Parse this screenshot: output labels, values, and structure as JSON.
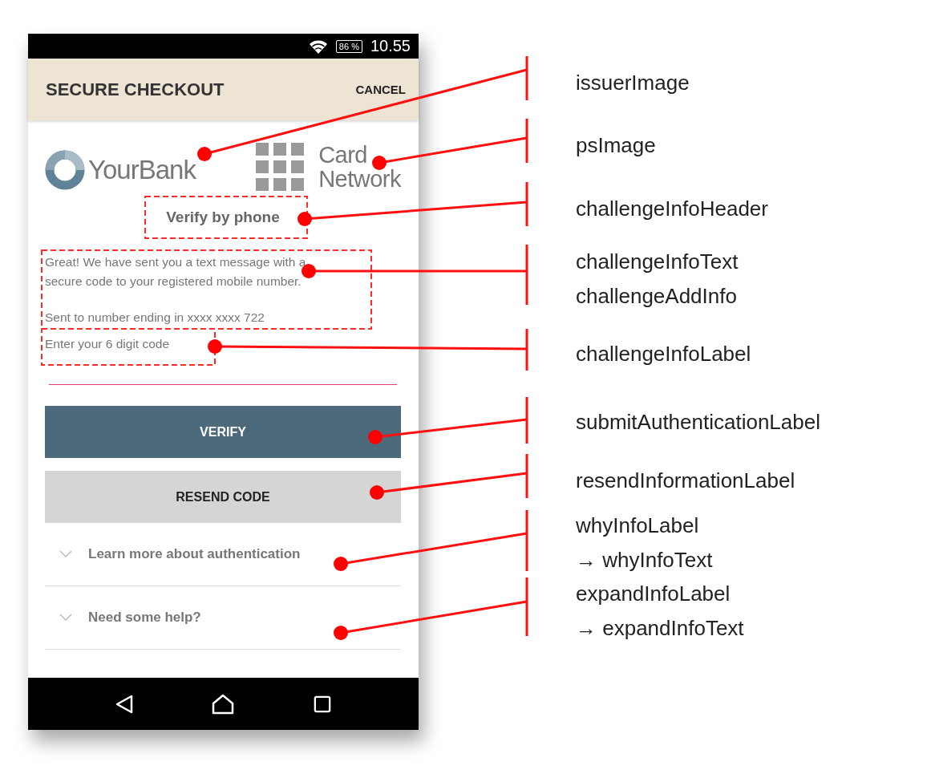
{
  "status_bar": {
    "battery": "86 %",
    "time": "10.55"
  },
  "app_bar": {
    "title": "SECURE CHECKOUT",
    "cancel": "CANCEL"
  },
  "issuer_logo": {
    "name": "YourBank"
  },
  "network_logo": {
    "lines": [
      "Card",
      "Network"
    ]
  },
  "challenge": {
    "header": "Verify by phone",
    "info_text": "Great! We have sent you a text message with a secure code to your registered mobile number.",
    "add_info": "Sent to number ending in xxxx xxxx 722",
    "label": "Enter your 6 digit code"
  },
  "buttons": [
    {
      "label": "VERIFY",
      "kind": "primary"
    },
    {
      "label": "RESEND CODE",
      "kind": "secondary"
    }
  ],
  "expanders": [
    {
      "label": "Learn more about authentication",
      "expanded": false
    },
    {
      "label": "Need some help?",
      "expanded": false
    }
  ],
  "annotations": [
    {
      "lines": [
        "issuerImage"
      ]
    },
    {
      "lines": [
        "psImage"
      ]
    },
    {
      "lines": [
        "challengeInfoHeader"
      ]
    },
    {
      "lines": [
        "challengeInfoText",
        "challengeAddInfo"
      ]
    },
    {
      "lines": [
        "challengeInfoLabel"
      ]
    },
    {
      "lines": [
        "submitAuthenticationLabel"
      ]
    },
    {
      "lines": [
        "resendInformationLabel"
      ]
    },
    {
      "lines": [
        "whyInfoLabel",
        "→ whyInfoText"
      ]
    },
    {
      "lines": [
        "expandInfoLabel",
        "→ expandInfoText"
      ]
    }
  ]
}
